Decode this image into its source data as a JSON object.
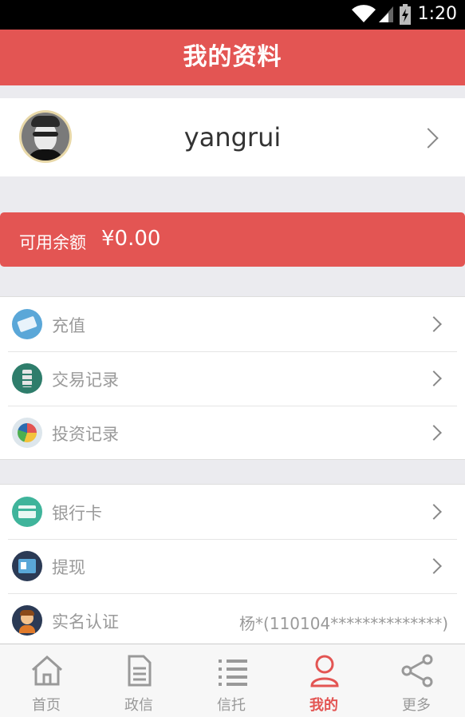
{
  "status_bar": {
    "time": "1:20"
  },
  "header": {
    "title": "我的资料"
  },
  "profile": {
    "username": "yangrui"
  },
  "balance": {
    "label": "可用余额",
    "amount": "¥0.00"
  },
  "menu_group_1": [
    {
      "label": "充值",
      "icon": "money-icon"
    },
    {
      "label": "交易记录",
      "icon": "ledger-icon"
    },
    {
      "label": "投资记录",
      "icon": "pie-chart-icon"
    }
  ],
  "menu_group_2": [
    {
      "label": "银行卡",
      "icon": "bank-card-icon"
    },
    {
      "label": "提现",
      "icon": "withdraw-icon"
    },
    {
      "label": "实名认证",
      "icon": "person-icon",
      "value": "杨*(110104**************)"
    }
  ],
  "tabs": [
    {
      "label": "首页",
      "icon": "home-icon"
    },
    {
      "label": "政信",
      "icon": "document-icon"
    },
    {
      "label": "信托",
      "icon": "list-icon"
    },
    {
      "label": "我的",
      "icon": "user-icon",
      "active": true
    },
    {
      "label": "更多",
      "icon": "share-icon"
    }
  ],
  "colors": {
    "accent": "#e35553",
    "background": "#ebebef",
    "text_muted": "#9a9a9a"
  }
}
